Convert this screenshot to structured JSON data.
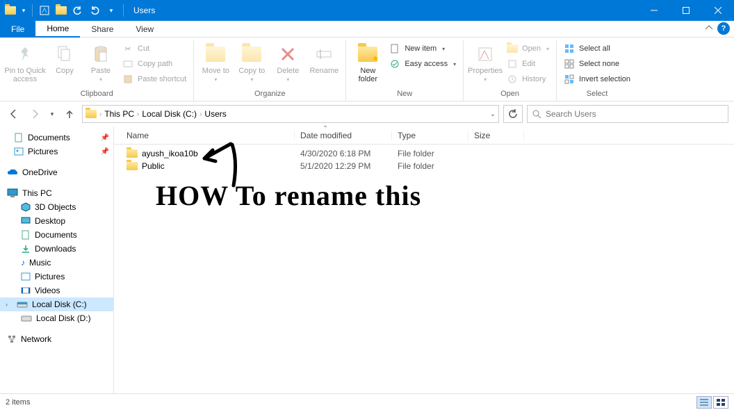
{
  "titlebar": {
    "title": "Users"
  },
  "tabs": {
    "file": "File",
    "home": "Home",
    "share": "Share",
    "view": "View"
  },
  "ribbon": {
    "clipboard": {
      "label": "Clipboard",
      "pin": "Pin to Quick access",
      "copy": "Copy",
      "paste": "Paste",
      "cut": "Cut",
      "copypath": "Copy path",
      "pasteshortcut": "Paste shortcut"
    },
    "organize": {
      "label": "Organize",
      "moveto": "Move to",
      "copyto": "Copy to",
      "delete": "Delete",
      "rename": "Rename"
    },
    "new": {
      "label": "New",
      "newfolder": "New folder",
      "newitem": "New item",
      "easyaccess": "Easy access"
    },
    "open": {
      "label": "Open",
      "properties": "Properties",
      "open": "Open",
      "edit": "Edit",
      "history": "History"
    },
    "select": {
      "label": "Select",
      "selectall": "Select all",
      "selectnone": "Select none",
      "invert": "Invert selection"
    }
  },
  "breadcrumb": {
    "pc": "This PC",
    "c": "Local Disk (C:)",
    "users": "Users"
  },
  "search": {
    "placeholder": "Search Users"
  },
  "columns": {
    "name": "Name",
    "date": "Date modified",
    "type": "Type",
    "size": "Size"
  },
  "nav": {
    "documents": "Documents",
    "pictures": "Pictures",
    "onedrive": "OneDrive",
    "thispc": "This PC",
    "obj3d": "3D Objects",
    "desktop": "Desktop",
    "documents2": "Documents",
    "downloads": "Downloads",
    "music": "Music",
    "pictures2": "Pictures",
    "videos": "Videos",
    "localc": "Local Disk (C:)",
    "locald": "Local Disk (D:)",
    "network": "Network"
  },
  "rows": [
    {
      "name": "ayush_ikoa10b",
      "date": "4/30/2020 6:18 PM",
      "type": "File folder"
    },
    {
      "name": "Public",
      "date": "5/1/2020 12:29 PM",
      "type": "File folder"
    }
  ],
  "status": {
    "count": "2 items"
  },
  "annotation": {
    "text": "HOW To rename this"
  }
}
